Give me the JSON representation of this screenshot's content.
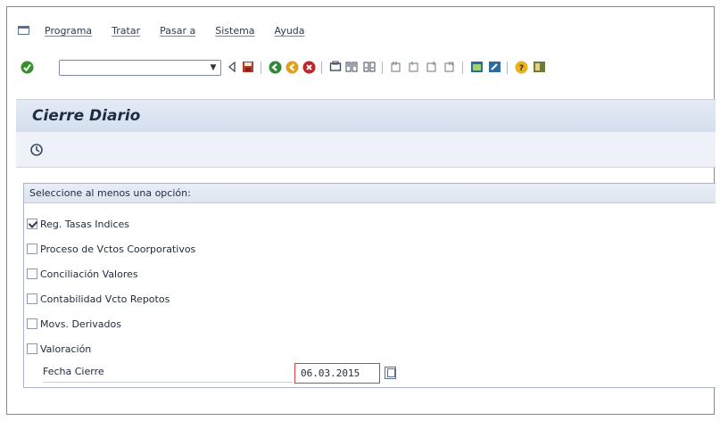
{
  "menubar": {
    "items": [
      "Programa",
      "Tratar",
      "Pasar a",
      "Sistema",
      "Ayuda"
    ]
  },
  "toolbar": {
    "command_value": "",
    "icons": [
      "enter-check-icon",
      "back-triangle-icon",
      "save-icon",
      "back-green-icon",
      "exit-yellow-icon",
      "cancel-red-icon",
      "print-icon",
      "find-icon",
      "find-next-icon",
      "first-page-icon",
      "prev-page-icon",
      "next-page-icon",
      "last-page-icon",
      "create-session-icon",
      "shortcut-icon",
      "help-icon",
      "layout-icon"
    ]
  },
  "header": {
    "title": "Cierre Diario"
  },
  "group": {
    "title": "Seleccione al menos una opción:",
    "options": [
      {
        "label": "Reg. Tasas Indices",
        "checked": true
      },
      {
        "label": "Proceso de Vctos Coorporativos",
        "checked": false
      },
      {
        "label": "Conciliación Valores",
        "checked": false
      },
      {
        "label": "Contabilidad Vcto Repotos",
        "checked": false
      },
      {
        "label": "Movs. Derivados",
        "checked": false
      },
      {
        "label": "Valoración",
        "checked": false
      }
    ],
    "fecha_label": "Fecha Cierre",
    "fecha_value": "06.03.2015"
  },
  "colors": {
    "title_bar": "#d3deed",
    "accent_green": "#3a8f2f",
    "accent_red": "#c0262a",
    "accent_yellow": "#e0a019"
  }
}
